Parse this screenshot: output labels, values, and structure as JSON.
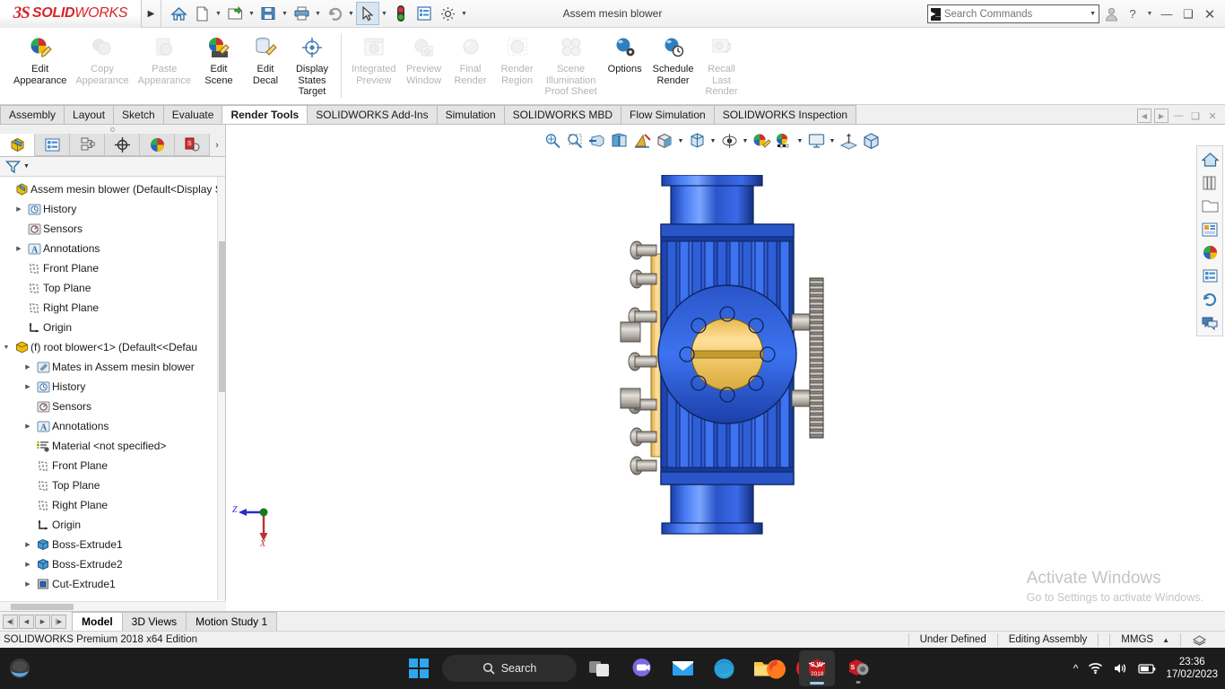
{
  "titlebar": {
    "logo_ds": "3S",
    "logo_solid": "SOLID",
    "logo_works": "WORKS",
    "document_title": "Assem mesin blower",
    "search_placeholder": "Search Commands",
    "icons": [
      "home-icon",
      "new-document-icon",
      "open-folder-icon",
      "save-icon",
      "print-icon",
      "undo-icon",
      "select-cursor-icon",
      "rebuild-icon",
      "options-list-icon",
      "settings-gear-icon"
    ],
    "window_buttons": [
      "user-account-icon",
      "help-icon",
      "minimize-icon",
      "restore-icon",
      "close-icon"
    ]
  },
  "ribbon": {
    "groups": [
      {
        "items": [
          {
            "label": "Edit\nAppearance",
            "name": "edit-appearance",
            "enabled": true,
            "icon": "appearance-pencil-icon"
          },
          {
            "label": "Copy\nAppearance",
            "name": "copy-appearance",
            "enabled": false,
            "icon": "copy-appearance-icon"
          },
          {
            "label": "Paste\nAppearance",
            "name": "paste-appearance",
            "enabled": false,
            "icon": "paste-appearance-icon"
          },
          {
            "label": "Edit\nScene",
            "name": "edit-scene",
            "enabled": true,
            "icon": "scene-pencil-icon"
          },
          {
            "label": "Edit\nDecal",
            "name": "edit-decal",
            "enabled": true,
            "icon": "decal-pencil-icon"
          },
          {
            "label": "Display\nStates\nTarget",
            "name": "display-states-target",
            "enabled": true,
            "icon": "target-crosshair-icon"
          }
        ]
      },
      {
        "items": [
          {
            "label": "Integrated\nPreview",
            "name": "integrated-preview",
            "enabled": false,
            "icon": "integrated-preview-icon"
          },
          {
            "label": "Preview\nWindow",
            "name": "preview-window",
            "enabled": false,
            "icon": "preview-window-icon"
          },
          {
            "label": "Final\nRender",
            "name": "final-render",
            "enabled": false,
            "icon": "final-render-icon"
          },
          {
            "label": "Render\nRegion",
            "name": "render-region",
            "enabled": false,
            "icon": "render-region-icon"
          },
          {
            "label": "Scene\nIllumination\nProof Sheet",
            "name": "scene-illumination-proof-sheet",
            "enabled": false,
            "icon": "proof-sheet-icon"
          },
          {
            "label": "Options",
            "name": "options",
            "enabled": true,
            "icon": "options-sphere-gear-icon"
          },
          {
            "label": "Schedule\nRender",
            "name": "schedule-render",
            "enabled": true,
            "icon": "schedule-clock-icon"
          },
          {
            "label": "Recall\nLast\nRender",
            "name": "recall-last-render",
            "enabled": false,
            "icon": "recall-render-icon"
          }
        ]
      }
    ]
  },
  "command_tabs": {
    "items": [
      {
        "label": "Assembly",
        "active": false
      },
      {
        "label": "Layout",
        "active": false
      },
      {
        "label": "Sketch",
        "active": false
      },
      {
        "label": "Evaluate",
        "active": false
      },
      {
        "label": "Render Tools",
        "active": true
      },
      {
        "label": "SOLIDWORKS Add-Ins",
        "active": false
      },
      {
        "label": "Simulation",
        "active": false
      },
      {
        "label": "SOLIDWORKS MBD",
        "active": false
      },
      {
        "label": "Flow Simulation",
        "active": false
      },
      {
        "label": "SOLIDWORKS Inspection",
        "active": false
      }
    ],
    "window_controls": [
      "prev-doc-icon",
      "next-doc-icon",
      "minimize-doc-icon",
      "restore-doc-icon",
      "close-doc-icon"
    ]
  },
  "left_panel": {
    "tabs": [
      {
        "name": "feature-manager-tab",
        "icon": "feature-tree-icon",
        "active": true
      },
      {
        "name": "property-manager-tab",
        "icon": "property-list-icon",
        "active": false
      },
      {
        "name": "configuration-manager-tab",
        "icon": "configuration-icon",
        "active": false
      },
      {
        "name": "dimxpert-manager-tab",
        "icon": "dimxpert-crosshair-icon",
        "active": false
      },
      {
        "name": "display-manager-tab",
        "icon": "display-sphere-icon",
        "active": false
      },
      {
        "name": "simulation-manager-tab",
        "icon": "simulation-icon",
        "active": false
      }
    ],
    "filter_icon": "filter-funnel-icon",
    "tree": [
      {
        "label": "Assem mesin blower  (Default<Display S",
        "indent": 0,
        "expander": "",
        "icon": "assembly-icon"
      },
      {
        "label": "History",
        "indent": 1,
        "expander": "collapsed",
        "icon": "history-icon"
      },
      {
        "label": "Sensors",
        "indent": 1,
        "expander": "",
        "icon": "sensors-icon"
      },
      {
        "label": "Annotations",
        "indent": 1,
        "expander": "collapsed",
        "icon": "annotations-icon"
      },
      {
        "label": "Front Plane",
        "indent": 1,
        "expander": "",
        "icon": "plane-icon"
      },
      {
        "label": "Top Plane",
        "indent": 1,
        "expander": "",
        "icon": "plane-icon"
      },
      {
        "label": "Right Plane",
        "indent": 1,
        "expander": "",
        "icon": "plane-icon"
      },
      {
        "label": "Origin",
        "indent": 1,
        "expander": "",
        "icon": "origin-icon"
      },
      {
        "label": "(f) root blower<1>  (Default<<Defau",
        "indent": 0,
        "expander": "expanded",
        "icon": "part-icon"
      },
      {
        "label": "Mates in Assem mesin blower",
        "indent": 2,
        "expander": "collapsed",
        "icon": "mates-icon"
      },
      {
        "label": "History",
        "indent": 2,
        "expander": "collapsed",
        "icon": "history-icon"
      },
      {
        "label": "Sensors",
        "indent": 2,
        "expander": "",
        "icon": "sensors-icon"
      },
      {
        "label": "Annotations",
        "indent": 2,
        "expander": "collapsed",
        "icon": "annotations-icon"
      },
      {
        "label": "Material <not specified>",
        "indent": 2,
        "expander": "",
        "icon": "material-icon"
      },
      {
        "label": "Front Plane",
        "indent": 2,
        "expander": "",
        "icon": "plane-icon"
      },
      {
        "label": "Top Plane",
        "indent": 2,
        "expander": "",
        "icon": "plane-icon"
      },
      {
        "label": "Right Plane",
        "indent": 2,
        "expander": "",
        "icon": "plane-icon"
      },
      {
        "label": "Origin",
        "indent": 2,
        "expander": "",
        "icon": "origin-icon"
      },
      {
        "label": "Boss-Extrude1",
        "indent": 2,
        "expander": "collapsed",
        "icon": "boss-extrude-icon"
      },
      {
        "label": "Boss-Extrude2",
        "indent": 2,
        "expander": "collapsed",
        "icon": "boss-extrude-icon"
      },
      {
        "label": "Cut-Extrude1",
        "indent": 2,
        "expander": "collapsed",
        "icon": "cut-extrude-icon"
      }
    ]
  },
  "viewport": {
    "toolbar_icons": [
      "zoom-to-fit-icon",
      "zoom-to-area-icon",
      "section-view-icon",
      "view-orientation-icon",
      "draft-analysis-icon",
      "display-style-icon",
      "hide-show-items-icon",
      "edit-appearance-icon",
      "apply-scene-icon",
      "view-settings-icon",
      "view-normal-to-icon",
      "3d-view-cube-icon"
    ],
    "sidebar_icons": [
      "home-view-icon",
      "appearances-library-icon",
      "design-library-icon",
      "file-explorer-icon",
      "view-palette-icon",
      "appearances-sphere-icon",
      "custom-properties-icon",
      "solidworks-forum-icon",
      "comments-icon"
    ],
    "triad": {
      "axis_z": "Z",
      "axis_x": "X"
    },
    "watermark": {
      "line1": "Activate Windows",
      "line2": "Go to Settings to activate Windows."
    },
    "model_colors": {
      "body_blue": "#1d4fd8",
      "body_blue_light": "#4a7bf0",
      "gold": "#f0c86a",
      "steel": "#b8b4ae"
    }
  },
  "bottom_tabs": {
    "nav_buttons": [
      "first-tab-icon",
      "prev-tab-icon",
      "next-tab-icon",
      "last-tab-icon"
    ],
    "items": [
      {
        "label": "Model",
        "active": true
      },
      {
        "label": "3D Views",
        "active": false
      },
      {
        "label": "Motion Study 1",
        "active": false
      }
    ]
  },
  "status_bar": {
    "edition": "SOLIDWORKS Premium 2018 x64 Edition",
    "sketch_status": "Under Defined",
    "edit_mode": "Editing Assembly",
    "units": "MMGS",
    "units_caret": "▲",
    "overlay_icon": "overlay-stack-icon"
  },
  "taskbar": {
    "start_icon": "windows-start-icon",
    "search_label": "Search",
    "search_icon": "search-icon",
    "apps": [
      {
        "name": "task-view-icon"
      },
      {
        "name": "chat-teams-icon"
      },
      {
        "name": "mail-icon"
      },
      {
        "name": "microsoft-edge-icon"
      },
      {
        "name": "file-explorer-icon"
      },
      {
        "name": "opera-icon"
      }
    ],
    "apps_right": [
      {
        "name": "firefox-icon",
        "running": false
      },
      {
        "name": "solidworks-2018-icon",
        "label": "2018",
        "active": true
      },
      {
        "name": "solidworks-viewer-icon",
        "running": true
      }
    ],
    "tray": {
      "chevron": "show-hidden-icons",
      "wifi": "wifi-icon",
      "volume": "volume-icon",
      "battery": "battery-icon",
      "time": "23:36",
      "date": "17/02/2023"
    }
  }
}
